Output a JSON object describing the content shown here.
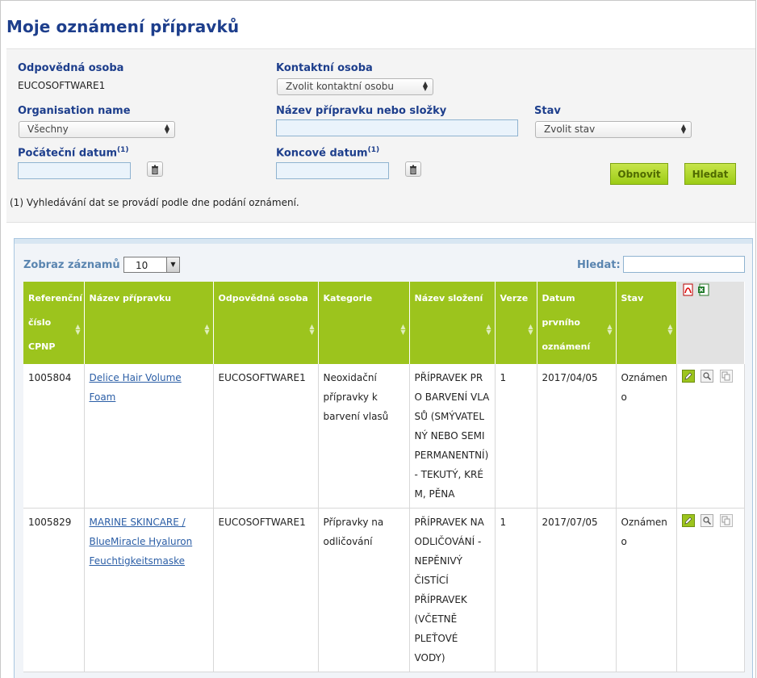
{
  "page": {
    "title": "Moje oznámení přípravků"
  },
  "filters": {
    "responsible_person": {
      "label": "Odpovědná osoba",
      "value": "EUCOSOFTWARE1"
    },
    "contact_person": {
      "label": "Kontaktní osoba",
      "selected": "Zvolit kontaktní osobu"
    },
    "organisation": {
      "label": "Organisation name",
      "selected": "Všechny"
    },
    "product_name": {
      "label": "Název přípravku nebo složky",
      "value": ""
    },
    "status": {
      "label": "Stav",
      "selected": "Zvolit stav"
    },
    "start_date": {
      "label": "Počáteční datum",
      "note_ref": "(1)",
      "value": ""
    },
    "end_date": {
      "label": "Koncové datum",
      "note_ref": "(1)",
      "value": ""
    },
    "reset_label": "Obnovit",
    "search_label": "Hledat",
    "footnote": "(1) Vyhledávání dat se provádí podle dne podání oznámení."
  },
  "results": {
    "show_label": "Zobraz záznamů",
    "page_size": "10",
    "search_label": "Hledat:",
    "search_value": "",
    "columns": [
      "Referenční číslo CPNP",
      "Název přípravku",
      "Odpovědná osoba",
      "Kategorie",
      "Název složení",
      "Verze",
      "Datum prvního oznámení",
      "Stav"
    ],
    "export_icons": [
      "pdf-export-icon",
      "excel-export-icon"
    ],
    "rows": [
      {
        "cpnp": "1005804",
        "name": "Delice Hair Volume Foam",
        "responsible": "EUCOSOFTWARE1",
        "category": "Neoxidační přípravky k barvení vlasů",
        "formulation": "PŘÍPRAVEK PRO BARVENÍ VLASŮ (SMÝVATELNÝ NEBO SEMIPERMANENTNÍ) - TEKUTÝ, KRÉM, PĚNA",
        "version": "1",
        "date": "2017/04/05",
        "status": "Oznámeno"
      },
      {
        "cpnp": "1005829",
        "name": "MARINE SKINCARE / BlueMiracle Hyaluron Feuchtigkeitsmaske",
        "responsible": "EUCOSOFTWARE1",
        "category": "Přípravky na odličování",
        "formulation": "PŘÍPRAVEK NA ODLIČOVÁNÍ - NEPĚNIVÝ ČISTÍCÍ PŘÍPRAVEK (VČETNĚ PLEŤOVÉ VODY)",
        "version": "1",
        "date": "2017/07/05",
        "status": "Oznámeno"
      }
    ]
  },
  "colors": {
    "title": "#1d3e8c",
    "header_green": "#9cc41d",
    "button_green": "#b3d92c",
    "link": "#2b5ea6"
  }
}
